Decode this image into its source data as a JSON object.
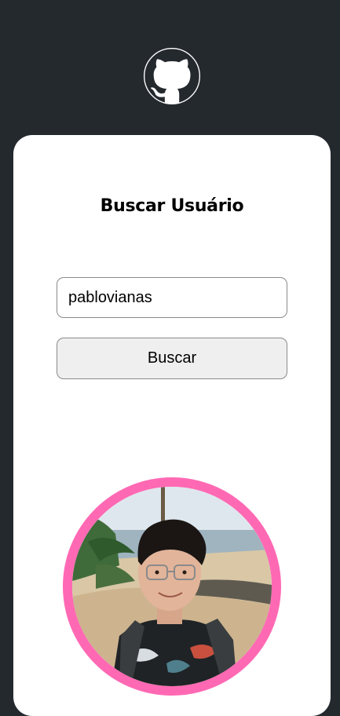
{
  "header": {
    "logo_icon": "github-icon"
  },
  "search": {
    "title": "Buscar Usuário",
    "input_value": "pablovianas",
    "button_label": "Buscar"
  },
  "profile": {
    "avatar_icon": "user-avatar-photo"
  },
  "colors": {
    "background": "#24292e",
    "card": "#ffffff",
    "avatar_border": "#ff69b4",
    "button_bg": "#efefef"
  }
}
